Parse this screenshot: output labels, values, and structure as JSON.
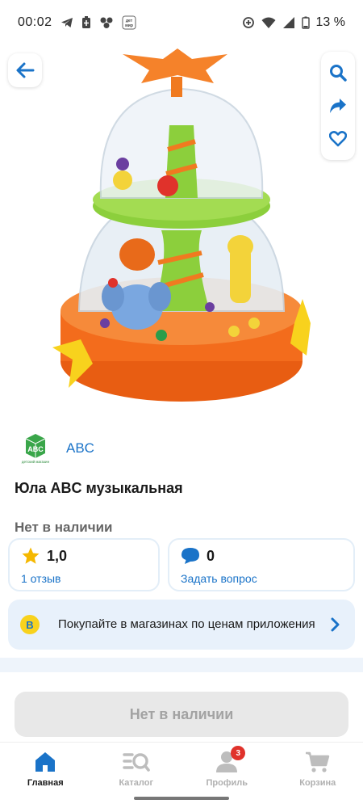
{
  "status_bar": {
    "time": "00:02",
    "battery": "13 %",
    "dm_text": "дет\nмир"
  },
  "product": {
    "brand_logo_text": "ABC",
    "brand_logo_caption": "детский магазин",
    "brand": "ABC",
    "title": "Юла ABC музыкальная",
    "availability": "Нет в наличии"
  },
  "rating_card": {
    "value": "1,0",
    "link": "1 отзыв"
  },
  "questions_card": {
    "value": "0",
    "link": "Задать вопрос"
  },
  "promo": {
    "badge": "B",
    "text": "Покупайте в магазинах по ценам приложения"
  },
  "buy_button": {
    "label": "Нет в наличии"
  },
  "bottom_nav": {
    "items": [
      {
        "label": "Главная",
        "icon": "home-icon",
        "active": true
      },
      {
        "label": "Каталог",
        "icon": "catalog-search-icon",
        "active": false
      },
      {
        "label": "Профиль",
        "icon": "profile-icon",
        "active": false,
        "badge": "3"
      },
      {
        "label": "Корзина",
        "icon": "cart-icon",
        "active": false
      }
    ]
  },
  "colors": {
    "accent": "#1a73c8",
    "star": "#f5b800",
    "badge": "#e0322b",
    "promo_bg": "#e8f1fb"
  }
}
